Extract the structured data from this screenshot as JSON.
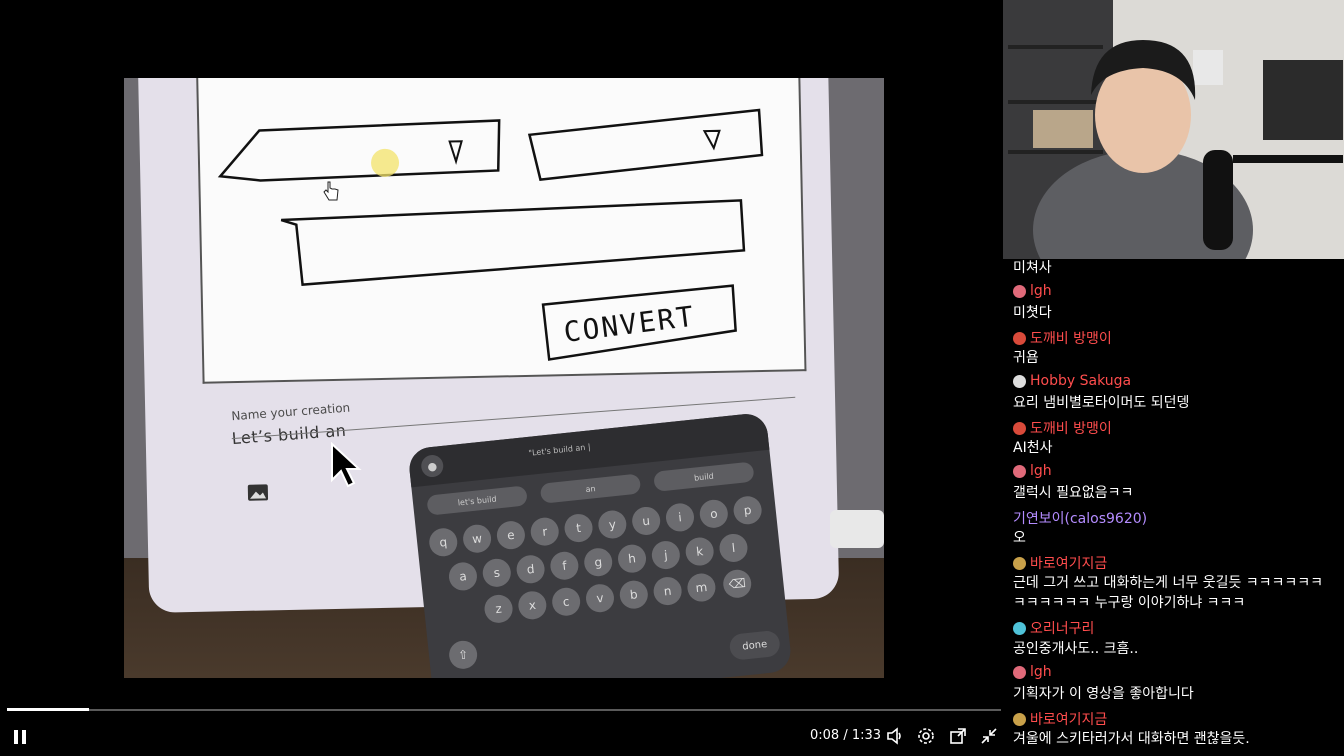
{
  "video": {
    "drawing_text": "CONVERT",
    "name_label": "Name your creation",
    "name_value": "Let’s build an",
    "keyboard": {
      "input_text": "\"Let's build an |",
      "suggestions": [
        "let's build",
        "an",
        "build"
      ],
      "rows": [
        [
          "q",
          "w",
          "e",
          "r",
          "t",
          "y",
          "u",
          "i",
          "o",
          "p"
        ],
        [
          "a",
          "s",
          "d",
          "f",
          "g",
          "h",
          "j",
          "k",
          "l"
        ],
        [
          "z",
          "x",
          "c",
          "v",
          "b",
          "n",
          "m"
        ]
      ],
      "done_label": "done"
    }
  },
  "player": {
    "time": "0:08 / 1:33",
    "progress_fraction": 0.082,
    "icons": [
      "pause-icon",
      "volume-icon",
      "settings-icon",
      "popout-icon",
      "exit-fullscreen-icon"
    ]
  },
  "chat": {
    "items": [
      {
        "text": "미쳐사"
      },
      {
        "user": "lgh",
        "color": "#ff4d4d",
        "badge": "#e06a7a"
      },
      {
        "text": "미쳣다"
      },
      {
        "user": "도깨비 방맹이",
        "color": "#ff4d4d",
        "badge": "#d94a3a"
      },
      {
        "text": "귀욤"
      },
      {
        "user": "Hobby Sakuga",
        "color": "#ff4d4d",
        "badge": "#dddddd"
      },
      {
        "text": "요리 냄비별로타이머도 되던뎅"
      },
      {
        "user": "도깨비 방맹이",
        "color": "#ff4d4d",
        "badge": "#d94a3a"
      },
      {
        "text": "AI천사"
      },
      {
        "user": "lgh",
        "color": "#ff4d4d",
        "badge": "#e06a7a"
      },
      {
        "text": "갤럭시 필요없음ㅋㅋ"
      },
      {
        "user": "기연보이(calos9620)",
        "color": "#b48cff",
        "badge": ""
      },
      {
        "text": "오"
      },
      {
        "user": "바로여기지금",
        "color": "#ff4d4d",
        "badge": "#c9a14a"
      },
      {
        "text": "근데 그거 쓰고 대화하는게 너무 웃길듯 ㅋㅋㅋㅋㅋㅋ"
      },
      {
        "text": "ㅋㅋㅋㅋㅋㅋ 누구랑 이야기하냐 ㅋㅋㅋ"
      },
      {
        "user": "오리너구리",
        "color": "#ff4d4d",
        "badge": "#4fc3d9"
      },
      {
        "text": "공인중개사도.. 크흠.."
      },
      {
        "user": "lgh",
        "color": "#ff4d4d",
        "badge": "#e06a7a"
      },
      {
        "text": "기획자가 이 영상을 좋아합니다"
      },
      {
        "user": "바로여기지금",
        "color": "#ff4d4d",
        "badge": "#c9a14a"
      },
      {
        "text": "겨울에 스키타러가서 대화하면 괜찮을듯."
      }
    ]
  }
}
